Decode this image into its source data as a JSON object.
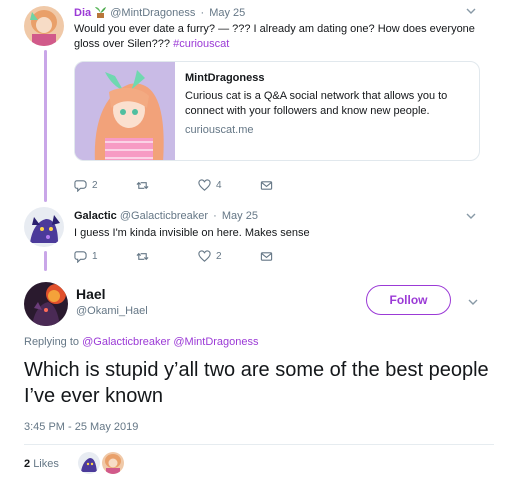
{
  "colors": {
    "accent": "#9b3ad6",
    "thread_line": "#c9a6e8",
    "secondary_text": "#657786"
  },
  "tweet1": {
    "name": "Dia",
    "handle": "@MintDragoness",
    "date": "May 25",
    "text": "Would you ever date a furry? — ??? I already am dating one? How does everyone gloss over Silen???",
    "hashtag": "#curiouscat",
    "card": {
      "title": "MintDragoness",
      "description": "Curious cat is a Q&A social network that allows you to connect with your followers and know new people.",
      "domain": "curiouscat.me"
    },
    "reply_count": "2",
    "like_count": "4"
  },
  "tweet2": {
    "name": "Galactic",
    "handle": "@Galacticbreaker",
    "date": "May 25",
    "text": "I guess I'm kinda invisible on here. Makes sense",
    "reply_count": "1",
    "like_count": "2"
  },
  "main_tweet": {
    "name": "Hael",
    "handle": "@Okami_Hael",
    "follow_label": "Follow",
    "replying_prefix": "Replying to",
    "mention1": "@Galacticbreaker",
    "mention2": "@MintDragoness",
    "text": "Which is stupid y’all two are some of the best people I’ve ever known",
    "timestamp": "3:45 PM - 25 May 2019",
    "likes_count": "2",
    "likes_label": "Likes"
  },
  "icons": {
    "reply": "reply-icon",
    "retweet": "retweet-icon",
    "like": "heart-icon",
    "message": "envelope-icon",
    "caret": "chevron-down-icon",
    "emoji": "plant-emoji-icon"
  }
}
